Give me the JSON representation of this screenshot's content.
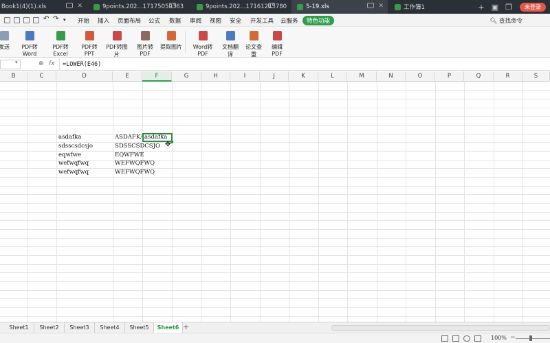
{
  "tabs": [
    {
      "label": "Book1(4)(1).xls"
    },
    {
      "label": "9points.202...17175059363"
    },
    {
      "label": "9points.202...17161245780"
    },
    {
      "label": "5-19.xls"
    },
    {
      "label": "工作簿1"
    }
  ],
  "titlebar": {
    "login": "未登录",
    "add_icon": "plus-icon"
  },
  "menu": [
    "开始",
    "插入",
    "页面布局",
    "公式",
    "数据",
    "审阅",
    "视图",
    "安全",
    "开发工具",
    "云服务",
    "特色功能"
  ],
  "search_cmd": "查找命令",
  "ribbon": [
    {
      "label": "发送",
      "icon": "send-icon"
    },
    {
      "label": "PDF转Word",
      "icon": "pdf-word-icon"
    },
    {
      "label": "PDF转Excel",
      "icon": "pdf-excel-icon"
    },
    {
      "label": "PDF转PPT",
      "icon": "pdf-ppt-icon"
    },
    {
      "label": "PDF转图片",
      "icon": "pdf-image-icon"
    },
    {
      "label": "图片转PDF",
      "icon": "image-pdf-icon"
    },
    {
      "label": "提取图片",
      "icon": "extract-image-icon"
    },
    {
      "label": "Word转PDF",
      "icon": "word-pdf-icon"
    },
    {
      "label": "文档翻译",
      "icon": "translate-icon"
    },
    {
      "label": "论文查重",
      "icon": "plagiarism-icon"
    },
    {
      "label": "编辑PDF",
      "icon": "edit-pdf-icon"
    }
  ],
  "formula_bar": {
    "fx": "fx",
    "formula": "=LOWER(E46)"
  },
  "columns": [
    "B",
    "C",
    "D",
    "E",
    "F",
    "G",
    "H",
    "I",
    "J",
    "K",
    "L",
    "M",
    "N",
    "O",
    "P",
    "Q",
    "R",
    "S"
  ],
  "selected_column": "F",
  "cells": {
    "d1": "asdafka",
    "d2": "sdsscsdcsjo",
    "d3": "eqwfwe",
    "d4": "wefwqfwq",
    "d5": "wefwqfwq",
    "e1": "ASDAFKA",
    "e2": "SDSSCSDCSJO",
    "e3": "EQWFWE",
    "e4": "WEFWQFWQ",
    "e5": "WEFWQFWQ",
    "f1": "asdafka"
  },
  "sheets": [
    "Sheet1",
    "Sheet2",
    "Sheet3",
    "Sheet4",
    "Sheet5",
    "Sheet6"
  ],
  "active_sheet": "Sheet6",
  "add_sheet": "+",
  "status": {
    "zoom": "100%",
    "zoom_minus": "−"
  },
  "colors": {
    "accent": "#2f9d4b",
    "titlebar": "#2b2f36",
    "login": "#e2574c"
  }
}
